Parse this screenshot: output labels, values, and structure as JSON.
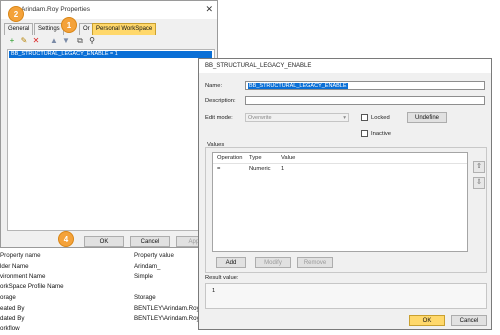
{
  "properties_window": {
    "title": "Arindam.Roy Properties",
    "close_glyph": "✕",
    "tabs": [
      "General",
      "Settings",
      "Or",
      "Personal WorkSpace"
    ],
    "selected_item": "BB_STRUCTURAL_LEGACY_ENABLE = 1",
    "buttons": {
      "ok": "OK",
      "cancel": "Cancel",
      "apply": "Apply"
    }
  },
  "background": {
    "name_column_header": "me",
    "table": {
      "header": [
        "Property name",
        "Property value"
      ],
      "rows": [
        [
          "lder Name",
          "Arindam_"
        ],
        [
          "vironment Name",
          "Simple"
        ],
        [
          "orkSpace Profile Name",
          ""
        ],
        [
          "orage",
          "Storage"
        ],
        [
          "eated By",
          "BENTLEY\\Arindam.Roy"
        ],
        [
          "dated By",
          "BENTLEY\\Arindam.Roy"
        ],
        [
          "orkflow",
          ""
        ]
      ]
    }
  },
  "dialog": {
    "title": "BB_STRUCTURAL_LEGACY_ENABLE",
    "name_label": "Name:",
    "name_value": "BB_STRUCTURAL_LEGACY_ENABLE",
    "description_label": "Description:",
    "description_value": "",
    "edit_mode_label": "Edit mode:",
    "edit_mode_value": "Overwrite",
    "locked_label": "Locked",
    "inactive_label": "Inactive",
    "undefine_button": "Undefine",
    "values_group_label": "Values",
    "columns": [
      "Operation",
      "Type",
      "Value"
    ],
    "rows": [
      {
        "operation": "=",
        "type": "Numeric",
        "value": "1"
      }
    ],
    "add_button": "Add",
    "modify_button": "Modify",
    "remove_button": "Remove",
    "result_label": "Result value:",
    "result_value": "1",
    "ok_button": "OK",
    "cancel_button": "Cancel"
  },
  "callouts": [
    "1",
    "2",
    "3",
    "4"
  ],
  "colors": {
    "badge": "#f4a23a",
    "tab_active": "#ffd86b",
    "selection": "#0a6fd6"
  }
}
